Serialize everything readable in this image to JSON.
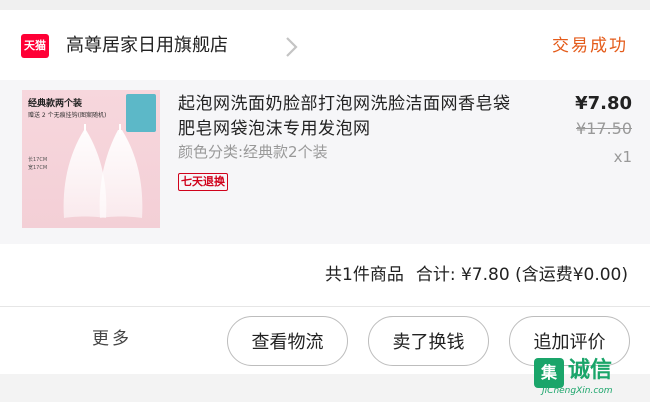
{
  "shop": {
    "badge": "天猫",
    "name": "高尊居家日用旗舰店",
    "status": "交易成功"
  },
  "item": {
    "title": "起泡网洗面奶脸部打泡网洗脸洁面网香皂袋肥皂网袋泡沫专用发泡网",
    "sku": "颜色分类:经典款2个装",
    "tag": "七天退换",
    "price": "¥7.80",
    "original_price": "¥17.50",
    "quantity": "x1",
    "thumb": {
      "title": "经典款两个装",
      "subtitle": "赠送 2 个无痕挂钩(图案随机)",
      "size1": "长17CM",
      "size2": "宽17CM"
    }
  },
  "summary": {
    "count": "共1件商品",
    "total_label": "合计:",
    "total": "¥7.80",
    "shipping": "(含运费¥0.00)"
  },
  "actions": {
    "more": "更多",
    "logistics": "查看物流",
    "resell": "卖了换钱",
    "review": "追加评价"
  },
  "watermark": {
    "logo": "集",
    "text": "诚信",
    "url": "JiChengXin.com"
  },
  "colors": {
    "tmall_red": "#ff0036",
    "status_orange": "#e45b1a",
    "tag_red": "#d0021b",
    "watermark_green": "#1aa56a"
  }
}
